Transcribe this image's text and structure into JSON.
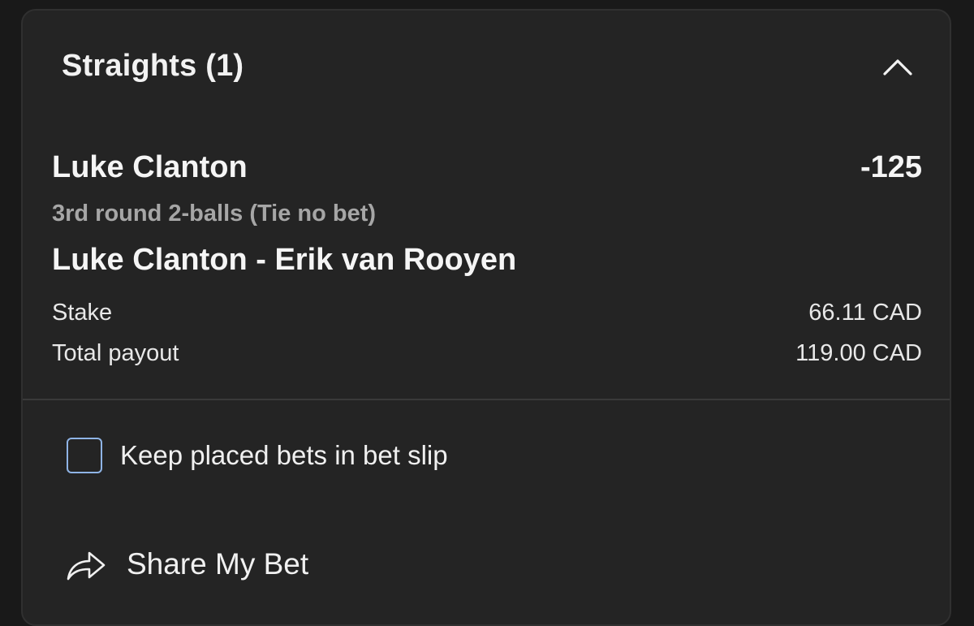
{
  "section": {
    "title": "Straights (1)"
  },
  "bet": {
    "selection": "Luke Clanton",
    "odds": "-125",
    "market": "3rd round 2-balls (Tie no bet)",
    "event": "Luke Clanton - Erik van Rooyen",
    "stake_label": "Stake",
    "stake_value": "66.11 CAD",
    "payout_label": "Total payout",
    "payout_value": "119.00 CAD"
  },
  "options": {
    "keep_bets_label": "Keep placed bets in bet slip",
    "keep_bets_checked": false
  },
  "share": {
    "label": "Share My Bet"
  },
  "icons": {
    "collapse": "chevron-up-icon",
    "share": "share-arrow-icon"
  },
  "colors": {
    "background": "#191919",
    "panel": "#242424",
    "checkbox_border": "#8fb4e6",
    "secondary_text": "#a6a6a6"
  }
}
